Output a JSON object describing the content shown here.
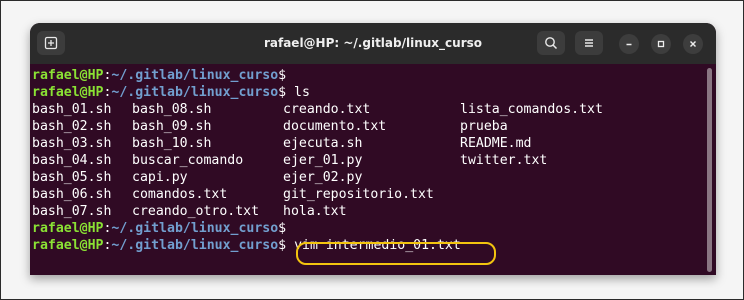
{
  "window": {
    "title": "rafael@HP: ~/.gitlab/linux_curso"
  },
  "prompt": {
    "user_host": "rafael@HP",
    "sep": ":",
    "path": "~/.gitlab/linux_curso",
    "symbol": "$"
  },
  "commands": {
    "first": " ls",
    "current": "vim intermedio_01.txt"
  },
  "listing": {
    "col1": [
      "bash_01.sh",
      "bash_02.sh",
      "bash_03.sh",
      "bash_04.sh",
      "bash_05.sh",
      "bash_06.sh",
      "bash_07.sh"
    ],
    "col2": [
      "bash_08.sh",
      "bash_09.sh",
      "bash_10.sh",
      "buscar_comando",
      "capi.py",
      "comandos.txt",
      "creando_otro.txt"
    ],
    "col3": [
      "creando.txt",
      "documento.txt",
      "ejecuta.sh",
      "ejer_01.py",
      "ejer_02.py",
      "git_repositorio.txt",
      "hola.txt"
    ],
    "col4": [
      "lista_comandos.txt",
      "prueba",
      "README.md",
      "twitter.txt"
    ]
  },
  "icons": {
    "new_tab": "new-tab-icon",
    "search": "search-icon",
    "menu": "hamburger-menu-icon",
    "minimize": "minimize-icon",
    "maximize": "maximize-icon",
    "close": "close-icon"
  },
  "colors": {
    "terminal_bg": "#300a24",
    "prompt_user": "#8ae234",
    "prompt_path": "#729fcf",
    "highlight": "#f2c40f",
    "titlebar": "#2b2b2b"
  }
}
